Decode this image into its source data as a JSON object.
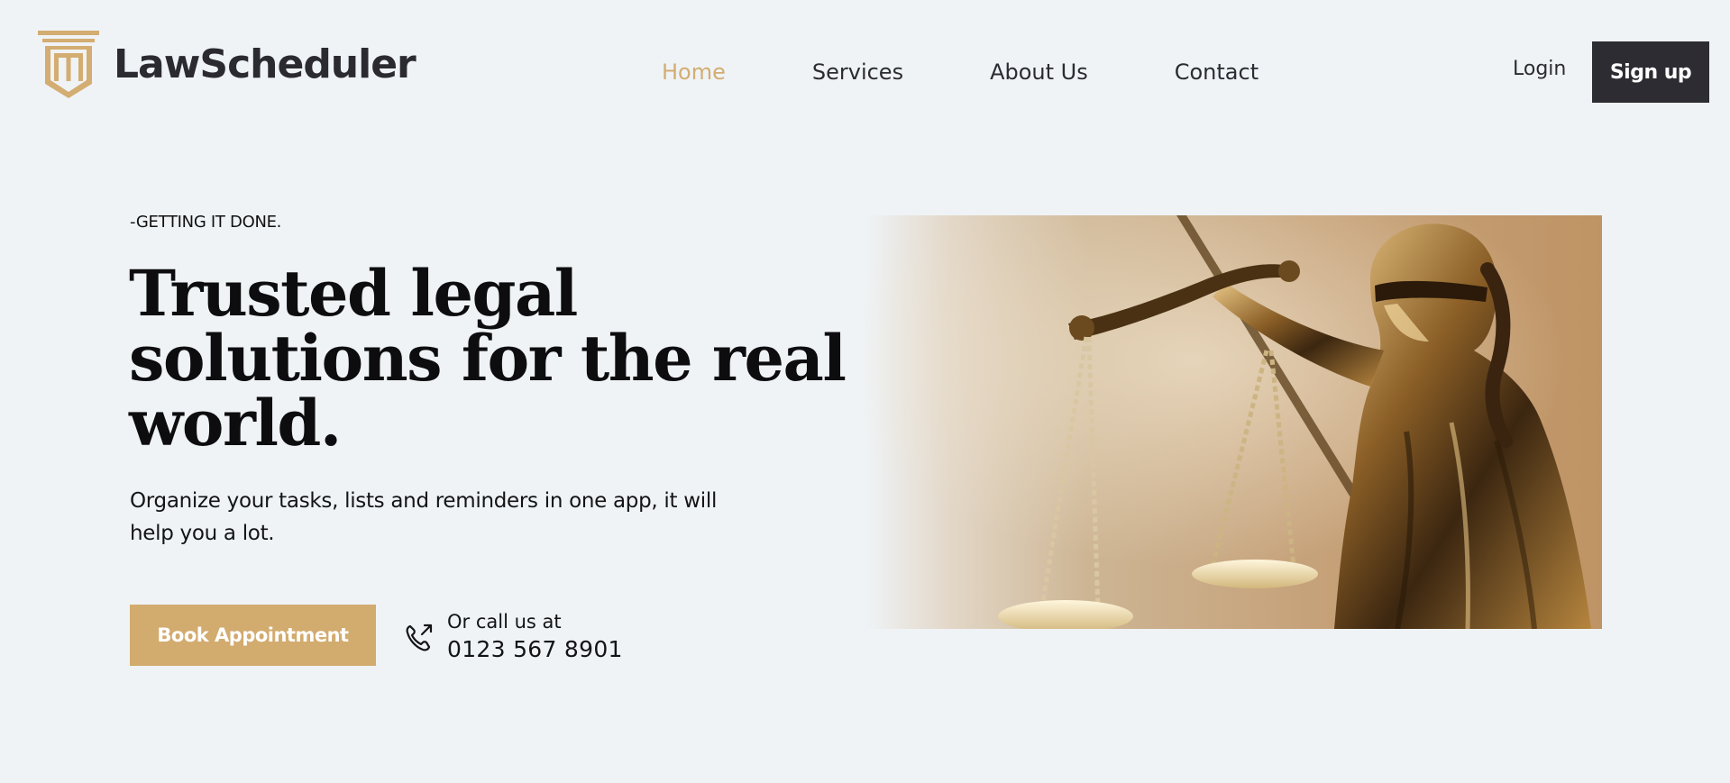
{
  "header": {
    "brand": "LawScheduler",
    "nav": [
      {
        "label": "Home",
        "active": true
      },
      {
        "label": "Services",
        "active": false
      },
      {
        "label": "About Us",
        "active": false
      },
      {
        "label": "Contact",
        "active": false
      }
    ],
    "login_label": "Login",
    "signup_label": "Sign up"
  },
  "hero": {
    "eyebrow": "-GETTING IT DONE.",
    "title": "Trusted legal solutions for the real world.",
    "description": "Organize your tasks, lists and reminders in one app, it will help you a lot.",
    "cta_label": "Book Appointment",
    "call_label": "Or call us at",
    "phone": "0123 567 8901",
    "phone_icon": "phone-outgoing-icon",
    "image": "lady-justice-statue-image"
  },
  "colors": {
    "background": "#eff3f6",
    "accent_gold": "#d2ab6e",
    "dark": "#2c2c32",
    "text": "#0d0d0f"
  }
}
